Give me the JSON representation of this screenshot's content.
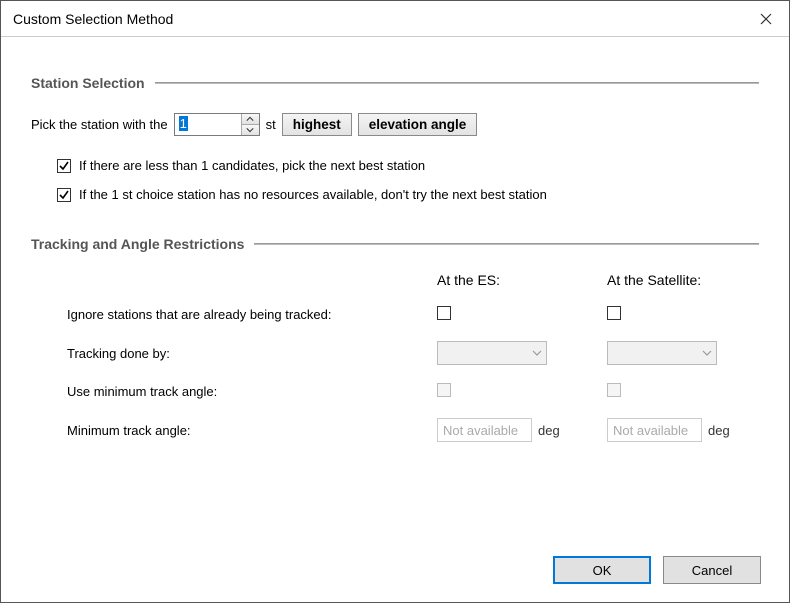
{
  "dialog": {
    "title": "Custom Selection Method"
  },
  "station_selection": {
    "heading": "Station Selection",
    "prefix": "Pick the station with the",
    "spin_value": "1",
    "ordinal_suffix": "st",
    "mode_btn": "highest",
    "metric_btn": "elevation angle",
    "chk1_label": "If there are less than 1 candidates, pick the next best station",
    "chk2_label": "If the 1 st choice station has no resources available, don't try the next best station"
  },
  "tracking": {
    "heading": "Tracking and Angle Restrictions",
    "col_es": "At the ES:",
    "col_sat": "At the Satellite:",
    "row_ignore": "Ignore stations that are already being tracked:",
    "row_trackby": "Tracking done by:",
    "row_usemin": "Use minimum track angle:",
    "row_minangle": "Minimum track angle:",
    "na": "Not available",
    "deg": "deg"
  },
  "footer": {
    "ok": "OK",
    "cancel": "Cancel"
  }
}
